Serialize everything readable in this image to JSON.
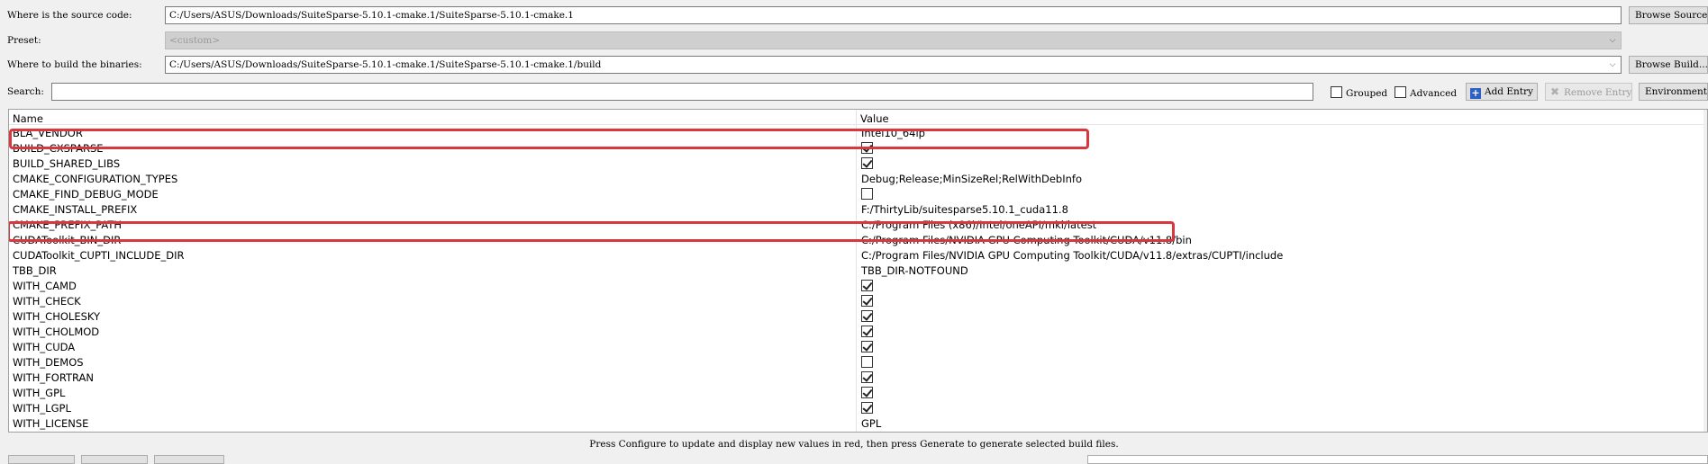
{
  "source": {
    "label": "Where is the source code:",
    "value": "C:/Users/ASUS/Downloads/SuiteSparse-5.10.1-cmake.1/SuiteSparse-5.10.1-cmake.1",
    "browse_label": "Browse Source..."
  },
  "preset": {
    "label": "Preset:",
    "value": "<custom>"
  },
  "build": {
    "label": "Where to build the binaries:",
    "value": "C:/Users/ASUS/Downloads/SuiteSparse-5.10.1-cmake.1/SuiteSparse-5.10.1-cmake.1/build",
    "browse_label": "Browse Build..."
  },
  "search": {
    "label": "Search:",
    "value": ""
  },
  "options": {
    "grouped": {
      "label": "Grouped",
      "checked": false
    },
    "advanced": {
      "label": "Advanced",
      "checked": false
    }
  },
  "toolbar": {
    "add_entry_label": "Add Entry",
    "remove_entry_label": "Remove Entry",
    "environment_label": "Environment..."
  },
  "table": {
    "headers": {
      "name": "Name",
      "value": "Value"
    },
    "rows": [
      {
        "name": "BLA_VENDOR",
        "type": "text",
        "value": "Intel10_64lp"
      },
      {
        "name": "BUILD_CXSPARSE",
        "type": "bool",
        "value": true
      },
      {
        "name": "BUILD_SHARED_LIBS",
        "type": "bool",
        "value": true
      },
      {
        "name": "CMAKE_CONFIGURATION_TYPES",
        "type": "text",
        "value": "Debug;Release;MinSizeRel;RelWithDebInfo"
      },
      {
        "name": "CMAKE_FIND_DEBUG_MODE",
        "type": "bool",
        "value": false
      },
      {
        "name": "CMAKE_INSTALL_PREFIX",
        "type": "text",
        "value": "F:/ThirtyLib/suitesparse5.10.1_cuda11.8"
      },
      {
        "name": "CMAKE_PREFIX_PATH",
        "type": "text",
        "value": "C:/Program Files (x86)/Intel/oneAPI/mkl/latest"
      },
      {
        "name": "CUDAToolkit_BIN_DIR",
        "type": "text",
        "value": "C:/Program Files/NVIDIA GPU Computing Toolkit/CUDA/v11.8/bin"
      },
      {
        "name": "CUDAToolkit_CUPTI_INCLUDE_DIR",
        "type": "text",
        "value": "C:/Program Files/NVIDIA GPU Computing Toolkit/CUDA/v11.8/extras/CUPTI/include"
      },
      {
        "name": "TBB_DIR",
        "type": "text",
        "value": "TBB_DIR-NOTFOUND"
      },
      {
        "name": "WITH_CAMD",
        "type": "bool",
        "value": true
      },
      {
        "name": "WITH_CHECK",
        "type": "bool",
        "value": true
      },
      {
        "name": "WITH_CHOLESKY",
        "type": "bool",
        "value": true
      },
      {
        "name": "WITH_CHOLMOD",
        "type": "bool",
        "value": true
      },
      {
        "name": "WITH_CUDA",
        "type": "bool",
        "value": true
      },
      {
        "name": "WITH_DEMOS",
        "type": "bool",
        "value": false
      },
      {
        "name": "WITH_FORTRAN",
        "type": "bool",
        "value": true
      },
      {
        "name": "WITH_GPL",
        "type": "bool",
        "value": true
      },
      {
        "name": "WITH_LGPL",
        "type": "bool",
        "value": true
      },
      {
        "name": "WITH_LICENSE",
        "type": "text",
        "value": "GPL"
      }
    ]
  },
  "status_text": "Press Configure to update and display new values in red, then press Generate to generate selected build files.",
  "colors": {
    "highlight": "#d9363e",
    "add_icon": "#2d5fc4"
  }
}
